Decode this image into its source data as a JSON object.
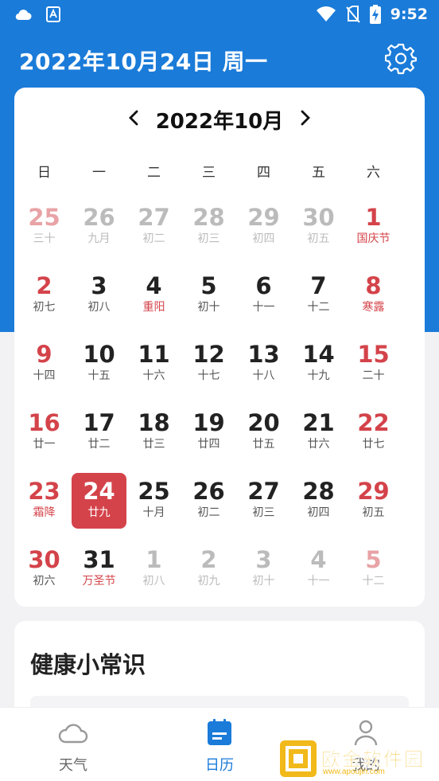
{
  "status_bar": {
    "time": "9:52"
  },
  "header": {
    "title": "2022年10月24日 周一"
  },
  "calendar": {
    "month_label": "2022年10月",
    "weekdays": [
      "日",
      "一",
      "二",
      "三",
      "四",
      "五",
      "六"
    ],
    "days": [
      {
        "num": "25",
        "lunar": "三十",
        "type": "other-weekend"
      },
      {
        "num": "26",
        "lunar": "九月",
        "type": "other"
      },
      {
        "num": "27",
        "lunar": "初二",
        "type": "other"
      },
      {
        "num": "28",
        "lunar": "初三",
        "type": "other"
      },
      {
        "num": "29",
        "lunar": "初四",
        "type": "other"
      },
      {
        "num": "30",
        "lunar": "初五",
        "type": "other"
      },
      {
        "num": "1",
        "lunar": "国庆节",
        "type": "weekend-holiday"
      },
      {
        "num": "2",
        "lunar": "初七",
        "type": "weekend"
      },
      {
        "num": "3",
        "lunar": "初八",
        "type": "normal"
      },
      {
        "num": "4",
        "lunar": "重阳",
        "type": "holiday"
      },
      {
        "num": "5",
        "lunar": "初十",
        "type": "normal"
      },
      {
        "num": "6",
        "lunar": "十一",
        "type": "normal"
      },
      {
        "num": "7",
        "lunar": "十二",
        "type": "normal"
      },
      {
        "num": "8",
        "lunar": "寒露",
        "type": "weekend-holiday"
      },
      {
        "num": "9",
        "lunar": "十四",
        "type": "weekend"
      },
      {
        "num": "10",
        "lunar": "十五",
        "type": "normal"
      },
      {
        "num": "11",
        "lunar": "十六",
        "type": "normal"
      },
      {
        "num": "12",
        "lunar": "十七",
        "type": "normal"
      },
      {
        "num": "13",
        "lunar": "十八",
        "type": "normal"
      },
      {
        "num": "14",
        "lunar": "十九",
        "type": "normal"
      },
      {
        "num": "15",
        "lunar": "二十",
        "type": "weekend"
      },
      {
        "num": "16",
        "lunar": "廿一",
        "type": "weekend"
      },
      {
        "num": "17",
        "lunar": "廿二",
        "type": "normal"
      },
      {
        "num": "18",
        "lunar": "廿三",
        "type": "normal"
      },
      {
        "num": "19",
        "lunar": "廿四",
        "type": "normal"
      },
      {
        "num": "20",
        "lunar": "廿五",
        "type": "normal"
      },
      {
        "num": "21",
        "lunar": "廿六",
        "type": "normal"
      },
      {
        "num": "22",
        "lunar": "廿七",
        "type": "weekend"
      },
      {
        "num": "23",
        "lunar": "霜降",
        "type": "weekend-holiday"
      },
      {
        "num": "24",
        "lunar": "廿九",
        "type": "selected"
      },
      {
        "num": "25",
        "lunar": "十月",
        "type": "normal"
      },
      {
        "num": "26",
        "lunar": "初二",
        "type": "normal"
      },
      {
        "num": "27",
        "lunar": "初三",
        "type": "normal"
      },
      {
        "num": "28",
        "lunar": "初四",
        "type": "normal"
      },
      {
        "num": "29",
        "lunar": "初五",
        "type": "weekend"
      },
      {
        "num": "30",
        "lunar": "初六",
        "type": "weekend"
      },
      {
        "num": "31",
        "lunar": "万圣节",
        "type": "holiday"
      },
      {
        "num": "1",
        "lunar": "初八",
        "type": "other"
      },
      {
        "num": "2",
        "lunar": "初九",
        "type": "other"
      },
      {
        "num": "3",
        "lunar": "初十",
        "type": "other"
      },
      {
        "num": "4",
        "lunar": "十一",
        "type": "other"
      },
      {
        "num": "5",
        "lunar": "十二",
        "type": "other-weekend"
      }
    ]
  },
  "health": {
    "title": "健康小常识"
  },
  "tabs": [
    {
      "label": "天气",
      "icon": "cloud-icon",
      "active": false
    },
    {
      "label": "日历",
      "icon": "calendar-icon",
      "active": true
    },
    {
      "label": "我的",
      "icon": "person-icon",
      "active": false
    }
  ],
  "watermark": {
    "text": "欧金软件园",
    "sub": "www.apoujin.com"
  },
  "colors": {
    "header_blue": "#1a7bd9",
    "accent_red": "#d4434a",
    "text_dark": "#222222",
    "text_muted": "#bbbbbb"
  }
}
